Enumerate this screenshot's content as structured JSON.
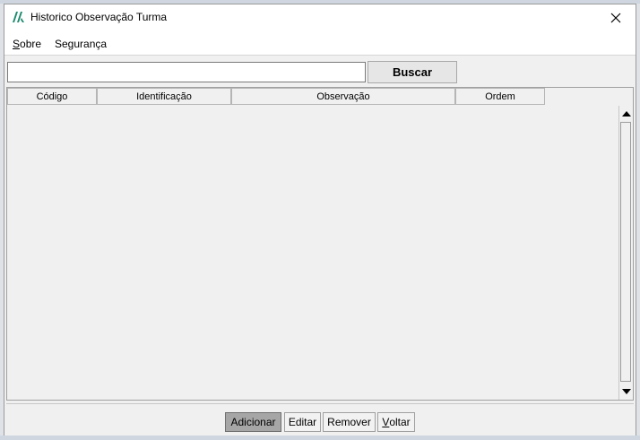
{
  "window": {
    "title": "Historico Observação Turma",
    "close_symbol": "✕"
  },
  "menu": {
    "items": [
      {
        "label_first": "S",
        "label_rest": "obre"
      },
      {
        "label": "Segurança"
      }
    ]
  },
  "search": {
    "value": "",
    "button_label": "Buscar"
  },
  "grid": {
    "columns": [
      "Código",
      "Identificação",
      "Observação",
      "Ordem"
    ],
    "rows": []
  },
  "footer": {
    "add_label": "Adicionar",
    "edit_label": "Editar",
    "remove_label": "Remover",
    "back_label_first": "V",
    "back_label_rest": "oltar"
  },
  "colors": {
    "accent_icon": "#1e8a6e",
    "active_button": "#a6a6a6"
  },
  "icons": {
    "app": "app-logo-icon",
    "close": "close-icon",
    "scroll_up": "scroll-up-arrow-icon",
    "scroll_down": "scroll-down-arrow-icon"
  }
}
